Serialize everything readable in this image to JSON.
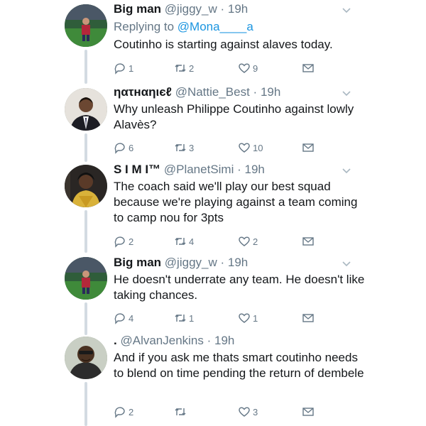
{
  "tweets": [
    {
      "name": "Big man",
      "handle": "@jiggy_w",
      "time": "19h",
      "replying_prefix": "Replying to ",
      "replying_to": "@Mona____a",
      "text": "Coutinho is starting against alaves today.",
      "replies": "1",
      "retweets": "2",
      "likes": "9"
    },
    {
      "name": "ηατнαηιєℓ",
      "handle": "@Nattie_Best",
      "time": "19h",
      "text": "Why unleash Philippe Coutinho against lowly Alavès?",
      "replies": "6",
      "retweets": "3",
      "likes": "10"
    },
    {
      "name": "S I M I™",
      "handle": "@PlanetSimi",
      "time": "19h",
      "text": "The coach said we'll play our best squad because we're playing against a team coming to camp nou for 3pts",
      "replies": "2",
      "retweets": "4",
      "likes": "2"
    },
    {
      "name": "Big man",
      "handle": "@jiggy_w",
      "time": "19h",
      "text": "He doesn't underrate any team. He doesn't like taking chances.",
      "replies": "4",
      "retweets": "1",
      "likes": "1"
    },
    {
      "name": ".",
      "handle": "@AlvanJenkins",
      "time": "19h",
      "text": "And if you ask me thats smart coutinho needs to blend on time pending the return of dembele",
      "replies": "2",
      "retweets": "",
      "likes": "3"
    }
  ],
  "separator": " · ",
  "icons": {
    "reply": "reply-icon",
    "retweet": "retweet-icon",
    "like": "heart-icon",
    "dm": "envelope-icon",
    "more": "chevron-down-icon"
  },
  "colors": {
    "text": "#14171a",
    "secondary": "#657786",
    "link": "#1b95e0",
    "thread": "#d3dbe2"
  }
}
